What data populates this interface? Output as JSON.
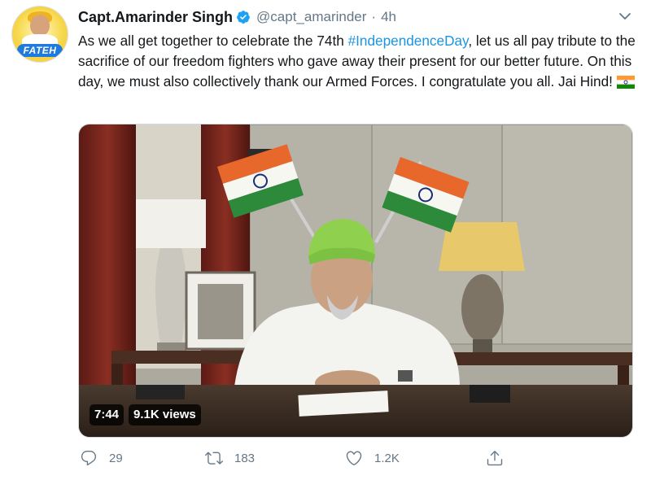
{
  "tweet": {
    "author": {
      "name": "Capt.Amarinder Singh",
      "handle": "@capt_amarinder",
      "avatar_badge": "FATEH",
      "verified": true
    },
    "separator": "·",
    "time": "4h",
    "text_before": "As we all get together to celebrate the 74th ",
    "hashtag": "#IndependenceDay",
    "text_after": ", let us all pay tribute to the sacrifice of our freedom fighters who gave away their present for our better future. On this day, we must also collectively thank our Armed Forces. I congratulate you all. Jai Hind!",
    "emoji": "india-flag"
  },
  "video": {
    "duration": "7:44",
    "views": "9.1K views"
  },
  "actions": {
    "replies": "29",
    "retweets": "183",
    "likes": "1.2K"
  },
  "icons": {
    "verified": "verified-badge-icon",
    "menu": "chevron-down-icon",
    "reply": "reply-icon",
    "retweet": "retweet-icon",
    "like": "heart-icon",
    "share": "share-icon"
  },
  "colors": {
    "link": "#1b95e0",
    "secondary_text": "#657786",
    "primary_text": "#14171a",
    "verified": "#1da1f2"
  }
}
